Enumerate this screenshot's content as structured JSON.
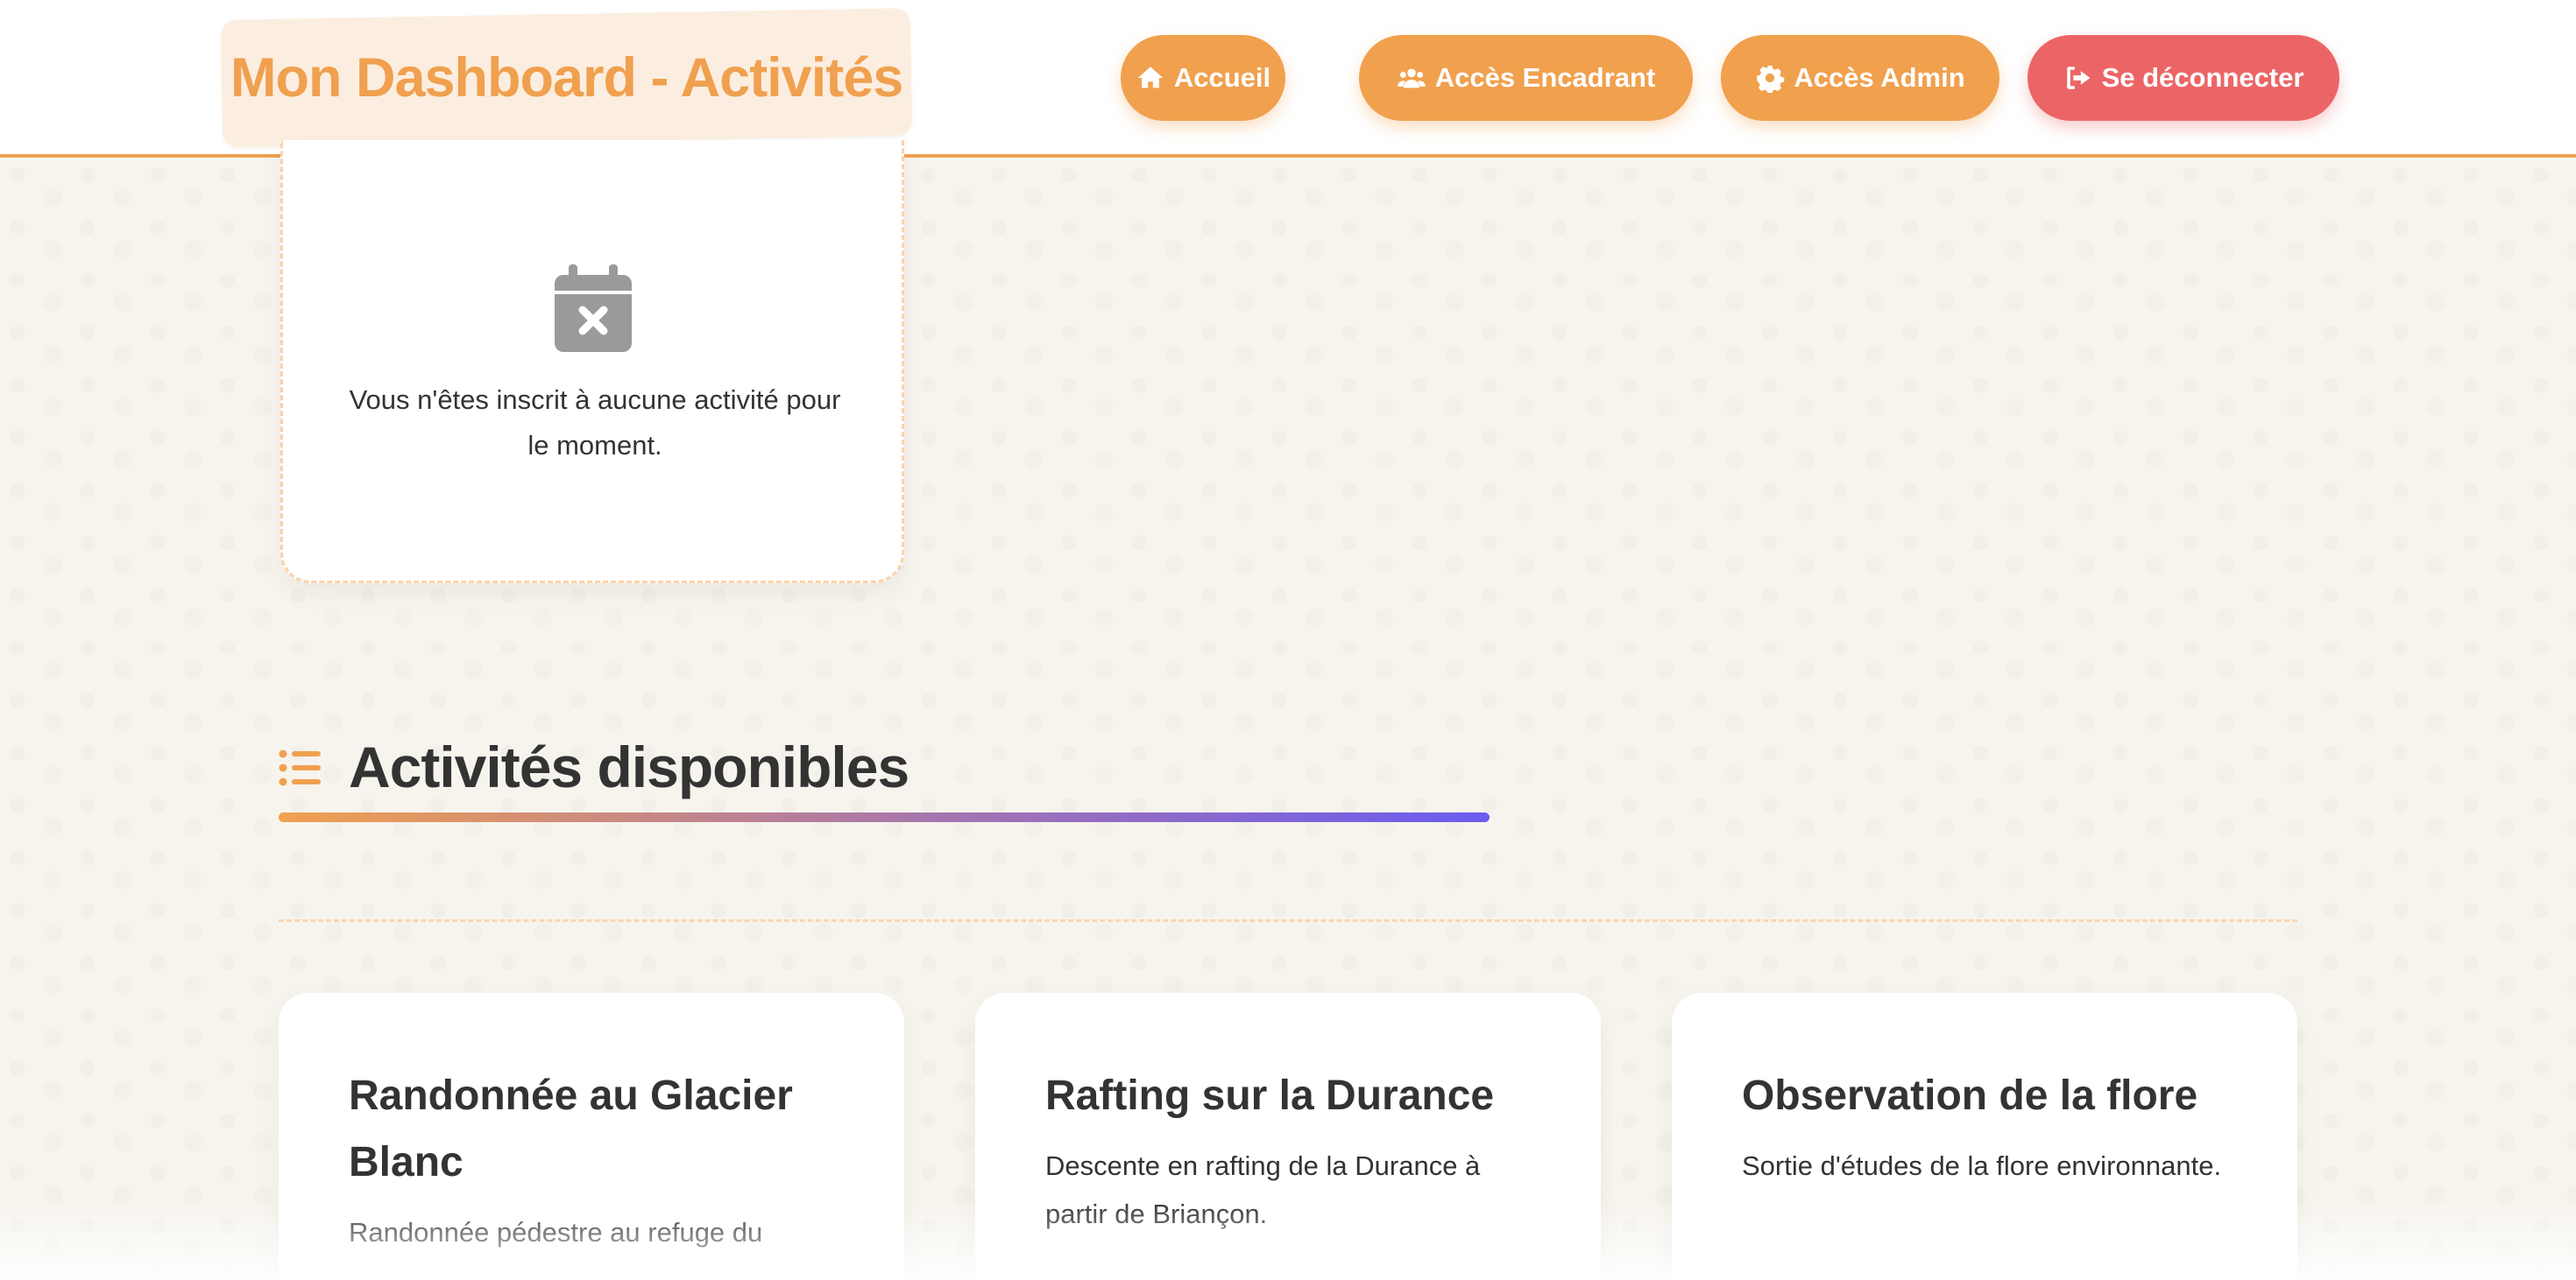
{
  "header": {
    "title": "Mon Dashboard - Activités",
    "nav": [
      {
        "label": "Accueil",
        "icon": "home-icon"
      },
      {
        "label": "Accès Encadrant",
        "icon": "users-icon"
      },
      {
        "label": "Accès Admin",
        "icon": "gear-icon"
      },
      {
        "label": "Se déconnecter",
        "icon": "logout-icon"
      }
    ]
  },
  "my_activities": {
    "empty_icon": "calendar-x-icon",
    "empty_message": "Vous n'êtes inscrit à aucune activité pour le moment."
  },
  "available": {
    "icon": "list-icon",
    "heading": "Activités disponibles",
    "activities": [
      {
        "title": "Randonnée au Glacier Blanc",
        "description": "Randonnée pédestre au refuge du"
      },
      {
        "title": "Rafting sur la Durance",
        "description": "Descente en rafting de la Durance à partir de Briançon."
      },
      {
        "title": "Observation de la flore",
        "description": "Sortie d'études de la flore environnante."
      }
    ]
  },
  "colors": {
    "primary": "#f1a04e",
    "danger": "#ec6566",
    "background": "#f7f4ee",
    "text": "#333333",
    "gradient_end": "#6a5cf0"
  }
}
